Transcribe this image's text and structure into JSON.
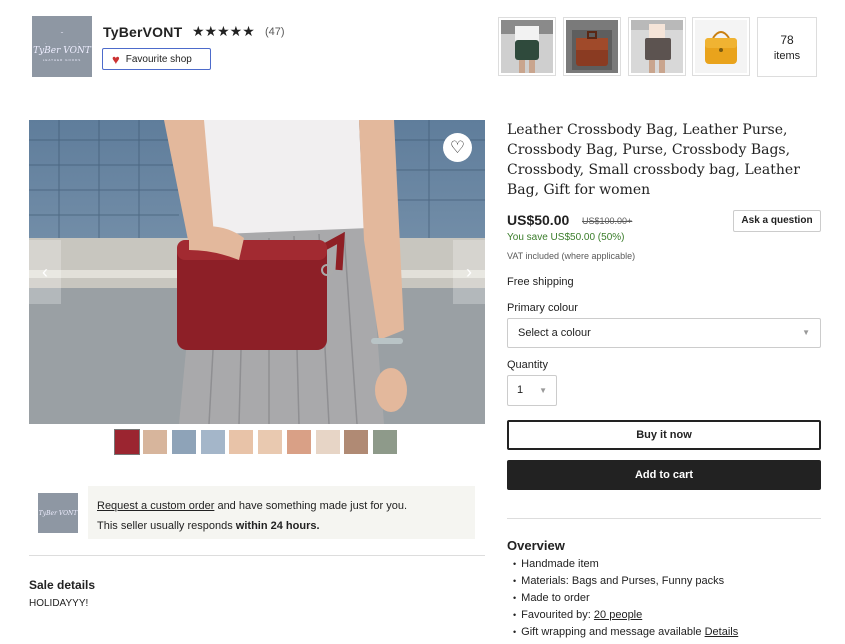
{
  "shop": {
    "logo_text": "TyBer VONT",
    "logo_sub": "LEATHER GOODS",
    "name": "TyBerVONT",
    "stars": "★★★★★",
    "review_count": "(47)",
    "favourite_label": "Favourite shop",
    "items_count": "78",
    "items_label": "items"
  },
  "listing": {
    "title": "Leather Crossbody Bag, Leather Purse, Crossbody Bag, Purse, Crossbody Bags, Crossbody, Small crossbody bag, Leather Bag, Gift for women",
    "price": "US$50.00",
    "old_price": "US$100.00+",
    "ask_label": "Ask a question",
    "save_text": "You save US$50.00 (50%)",
    "vat_text": "VAT included (where applicable)",
    "shipping_text": "Free shipping",
    "colour_label": "Primary colour",
    "colour_placeholder": "Select a colour",
    "quantity_label": "Quantity",
    "quantity_value": "1",
    "buy_label": "Buy it now",
    "cart_label": "Add to cart"
  },
  "custom_order": {
    "link_text": "Request a custom order",
    "rest_text": " and have something made just for you.",
    "response_prefix": "This seller usually responds ",
    "response_time": "within 24 hours."
  },
  "sale": {
    "title": "Sale details",
    "text": "HOLIDAYYY!"
  },
  "overview": {
    "title": "Overview",
    "items": [
      "Handmade item",
      "Materials: Bags and Purses, Funny packs",
      "Made to order"
    ],
    "favourited_prefix": "Favourited by: ",
    "favourited_link": "20 people",
    "gift_prefix": "Gift wrapping and message available ",
    "gift_link": "Details"
  },
  "colors": {
    "accent_blue": "#4d6bcb",
    "save_green": "#3a7d2a",
    "dark": "#222222"
  }
}
